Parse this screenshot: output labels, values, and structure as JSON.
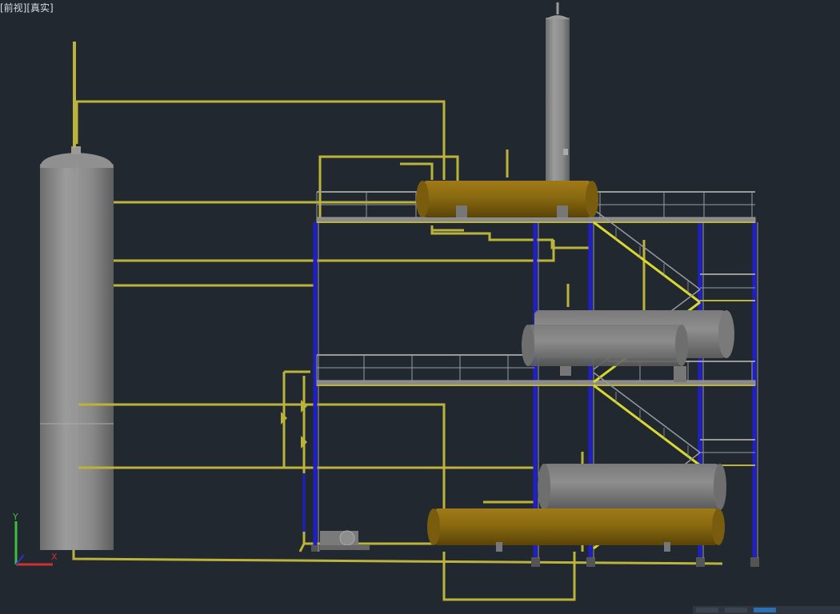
{
  "viewport": {
    "label": "[前视][真实]",
    "background": "#212830"
  },
  "colors": {
    "pipe": "#bcb43a",
    "steel_blue": "#1f1fc8",
    "steel_gray": "#9a9a9a",
    "vessel_gray": "#8c8c8c",
    "vessel_brown": "#8a6a10",
    "stair_yellow": "#d8d830"
  },
  "ucs": {
    "icon": "ucs-axis-icon",
    "y_label": "Y",
    "x_label": "X"
  },
  "statusbar": {
    "icons": [
      "model-space-icon",
      "grid-icon",
      "workspace-icon"
    ]
  }
}
